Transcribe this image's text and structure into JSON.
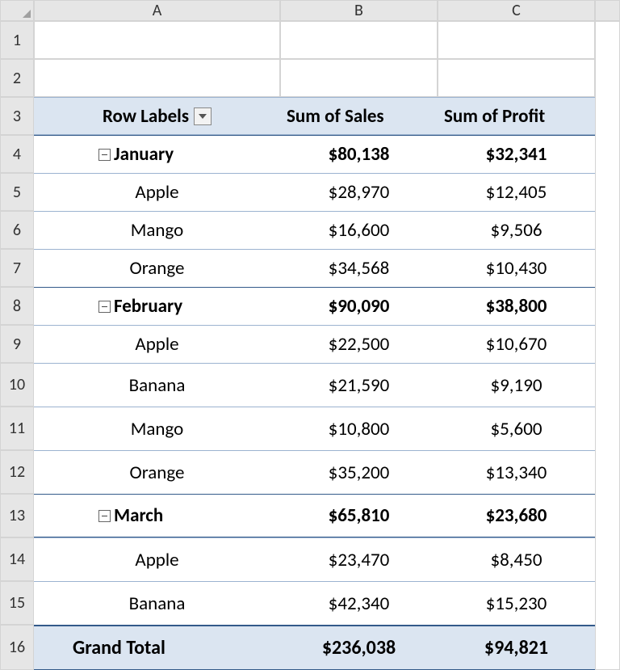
{
  "columns": [
    "A",
    "B",
    "C"
  ],
  "rows": [
    "1",
    "2",
    "3",
    "4",
    "5",
    "6",
    "7",
    "8",
    "9",
    "10",
    "11",
    "12",
    "13",
    "14",
    "15",
    "16"
  ],
  "header": {
    "row_labels": "Row Labels",
    "col_b": "Sum of Sales",
    "col_c": "Sum of Profit"
  },
  "groups": [
    {
      "name": "January",
      "sales": "$80,138",
      "profit": "$32,341",
      "items": [
        {
          "name": "Apple",
          "sales": "$28,970",
          "profit": "$12,405"
        },
        {
          "name": "Mango",
          "sales": "$16,600",
          "profit": "$9,506"
        },
        {
          "name": "Orange",
          "sales": "$34,568",
          "profit": "$10,430"
        }
      ]
    },
    {
      "name": "February",
      "sales": "$90,090",
      "profit": "$38,800",
      "items": [
        {
          "name": "Apple",
          "sales": "$22,500",
          "profit": "$10,670"
        },
        {
          "name": "Banana",
          "sales": "$21,590",
          "profit": "$9,190"
        },
        {
          "name": "Mango",
          "sales": "$10,800",
          "profit": "$5,600"
        },
        {
          "name": "Orange",
          "sales": "$35,200",
          "profit": "$13,340"
        }
      ]
    },
    {
      "name": "March",
      "sales": "$65,810",
      "profit": "$23,680",
      "items": [
        {
          "name": "Apple",
          "sales": "$23,470",
          "profit": "$8,450"
        },
        {
          "name": "Banana",
          "sales": "$42,340",
          "profit": "$15,230"
        }
      ]
    }
  ],
  "grand": {
    "label": "Grand Total",
    "sales": "$236,038",
    "profit": "$94,821"
  }
}
